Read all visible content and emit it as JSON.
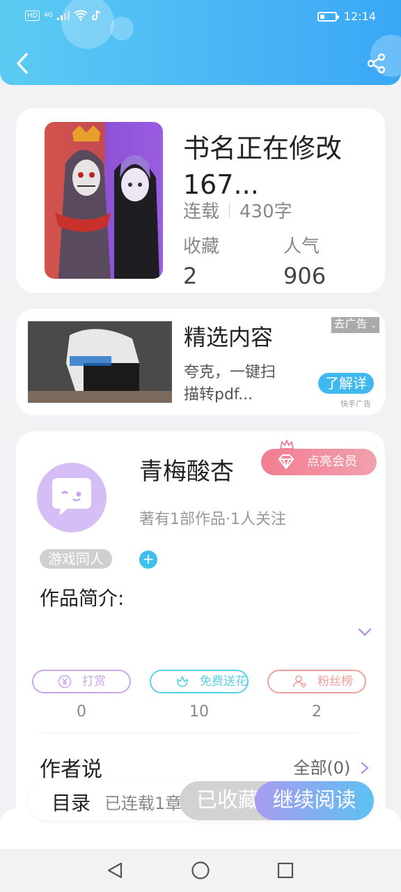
{
  "status_bar": {
    "network": "HD",
    "signal_label": "4G",
    "time": "12:14"
  },
  "header": {
    "back_icon": "chevron-left-icon",
    "share_icon": "share-icon"
  },
  "book": {
    "title": "书名正在修改167...",
    "status": "连载",
    "word_count": "430字",
    "favorites_label": "收藏",
    "favorites_value": "2",
    "popularity_label": "人气",
    "popularity_value": "906"
  },
  "ad": {
    "close_label": "去广告",
    "title": "精选内容",
    "description": "夸克，一键扫描转pdf...",
    "cta_label": "了解详",
    "source": "快手广告"
  },
  "author": {
    "name": "青梅酸杏",
    "vip_label": "点亮会员",
    "info": "著有1部作品·1人关注",
    "tag": "游戏同人",
    "intro_label": "作品简介:",
    "actions": [
      {
        "label": "打赏",
        "count": "0",
        "icon": "yuan-icon",
        "color": "#c9a6ee"
      },
      {
        "label": "免费送花",
        "count": "10",
        "icon": "flower-icon",
        "color": "#5cd0e6"
      },
      {
        "label": "粉丝榜",
        "count": "2",
        "icon": "fans-icon",
        "color": "#f0a09a"
      }
    ],
    "author_says_label": "作者说",
    "all_label": "全部(0)"
  },
  "bottom_bar": {
    "toc_label": "目录",
    "serial_text": "已连载1章",
    "fav_label": "已收藏",
    "read_label": "继续阅读"
  },
  "colors": {
    "header_start": "#5ccbf3",
    "header_end": "#3aa7f6",
    "accent_blue": "#3fb7ef",
    "vip_pink": "#f27d91"
  }
}
